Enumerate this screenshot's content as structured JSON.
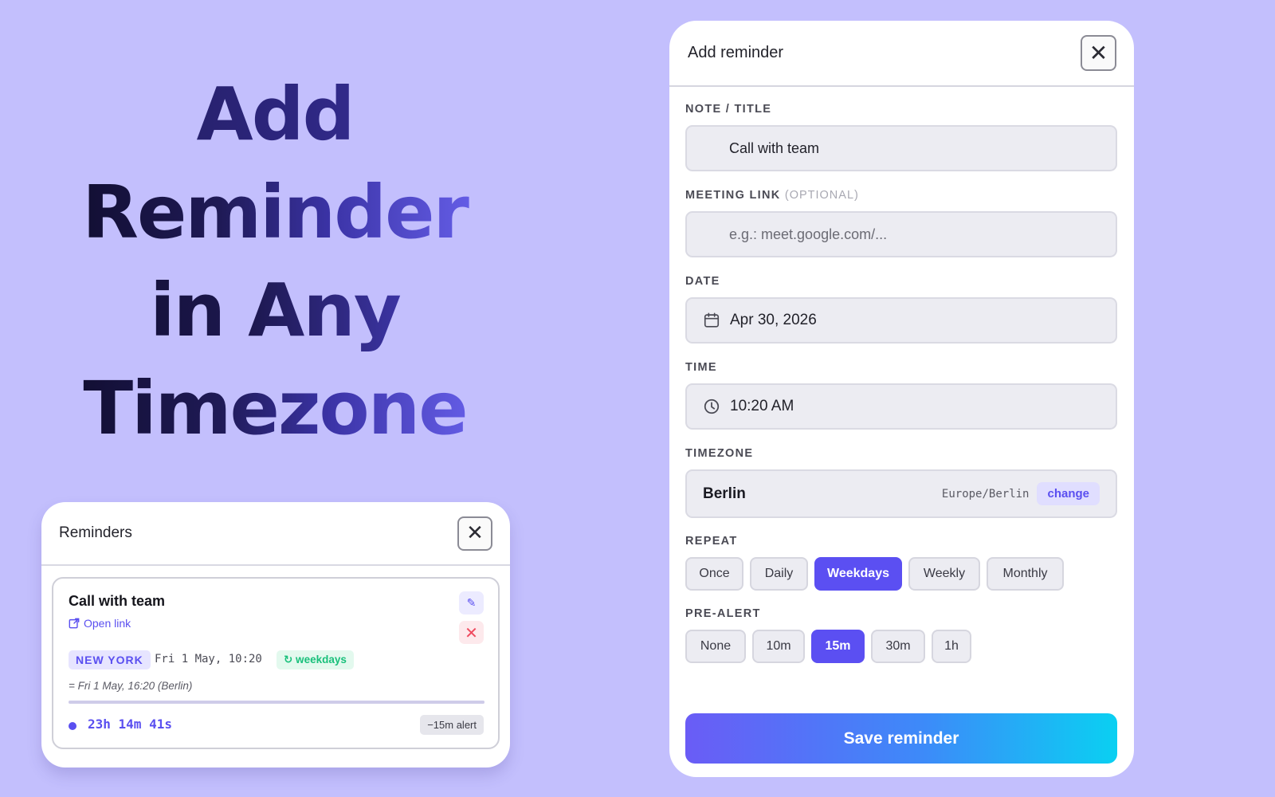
{
  "hero": {
    "line1": "Add",
    "line2": "Reminder",
    "line3": "in Any",
    "line4": "Timezone"
  },
  "reminders_panel": {
    "title": "Reminders",
    "close_label": "✕",
    "item": {
      "name": "Call with team",
      "open_link_label": "Open link",
      "edit_label": "✎",
      "delete_label": "✕",
      "city": "NEW YORK",
      "original_time": "Fri 1 May, 10:20",
      "repeat": "↻ weekdays",
      "converted_time": "= Fri 1 May, 16:20 (Berlin)",
      "countdown": "23h 14m 41s",
      "alert": "−15m alert"
    }
  },
  "form": {
    "title": "Add reminder",
    "close_label": "✕",
    "note_label": "NOTE / TITLE",
    "note_value": "Call with team",
    "link_label": "MEETING LINK",
    "link_optional": "(OPTIONAL)",
    "link_placeholder": "e.g.: meet.google.com/...",
    "date_label": "DATE",
    "date_value": "Apr 30, 2026",
    "time_label": "TIME",
    "time_value": "10:20 AM",
    "timezone_label": "TIMEZONE",
    "timezone_city": "Berlin",
    "timezone_id": "Europe/Berlin",
    "timezone_change": "change",
    "repeat_label": "REPEAT",
    "repeat_options": [
      "Once",
      "Daily",
      "Weekdays",
      "Weekly",
      "Monthly"
    ],
    "repeat_selected": "Weekdays",
    "prealert_label": "PRE-ALERT",
    "prealert_options": [
      "None",
      "10m",
      "15m",
      "30m",
      "1h"
    ],
    "prealert_selected": "15m",
    "save_label": "Save reminder"
  },
  "colors": {
    "background": "#c3bffd",
    "accent": "#5b4ff2",
    "success": "#19c07b",
    "danger": "#ef4b5f"
  },
  "icons": {
    "calendar": "calendar-icon",
    "clock": "clock-icon",
    "external_link": "external-link-icon",
    "edit": "pencil-icon",
    "delete": "x-icon",
    "close": "close-icon"
  }
}
